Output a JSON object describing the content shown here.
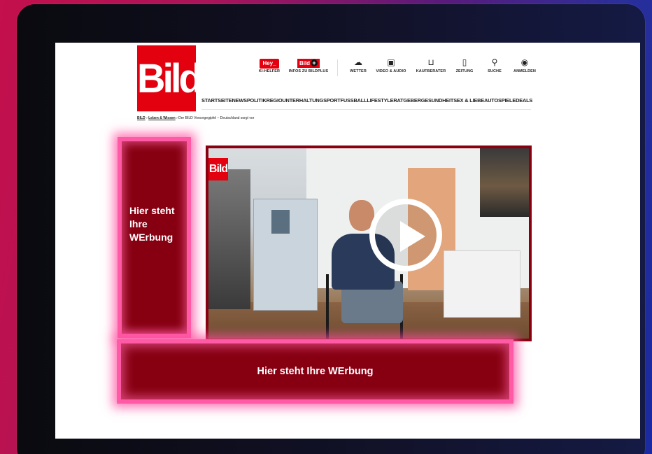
{
  "logo": {
    "text": "Bild"
  },
  "topnav": [
    {
      "badge": "Hey_",
      "label": "KI-HELFER",
      "icon": "hey-badge"
    },
    {
      "badge": "Bild",
      "label": "INFOS ZU BILDPLUS",
      "icon": "bildplus-badge"
    },
    {
      "label": "WETTER",
      "icon": "cloud-icon"
    },
    {
      "label": "VIDEO & AUDIO",
      "icon": "play-square-icon"
    },
    {
      "label": "KAUFBERATER",
      "icon": "cart-icon"
    },
    {
      "label": "ZEITUNG",
      "icon": "newspaper-icon"
    },
    {
      "label": "SUCHE",
      "icon": "search-icon"
    },
    {
      "label": "ANMELDEN",
      "icon": "user-icon"
    }
  ],
  "mainnav": [
    "STARTSEITE",
    "NEWS",
    "POLITIK",
    "REGIO",
    "UNTERHALTUNG",
    "SPORT",
    "FUSSBALL",
    "LIFESTYLE",
    "RATGEBER",
    "GESUNDHEIT",
    "SEX & LIEBE",
    "AUTO",
    "SPIELE",
    "DEALS"
  ],
  "breadcrumb": {
    "home": "BILD",
    "section": "Leben & Wissen",
    "current": "Der BILD Vorsorgegipfel – Deutschland sorgt vor",
    "sep": "›"
  },
  "video": {
    "logo": "Bild",
    "icon": "play-icon"
  },
  "ads": {
    "side": "Hier steht Ihre WErbung",
    "bottom": "Hier steht Ihre WErbung"
  },
  "colors": {
    "brand": "#e3000f",
    "ad_fill": "#870012",
    "ad_glow": "#ff5aa6"
  }
}
